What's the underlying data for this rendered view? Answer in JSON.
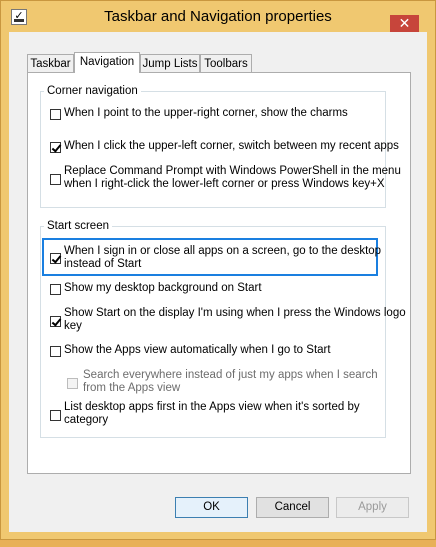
{
  "window": {
    "title": "Taskbar and Navigation properties",
    "close_glyph": "✕"
  },
  "tabs": [
    {
      "label": "Taskbar",
      "active": false
    },
    {
      "label": "Navigation",
      "active": true
    },
    {
      "label": "Jump Lists",
      "active": false
    },
    {
      "label": "Toolbars",
      "active": false
    }
  ],
  "corner_navigation": {
    "heading": "Corner navigation",
    "options": [
      {
        "lines": [
          "When I point to the upper-right corner, show the charms"
        ],
        "checked": false,
        "enabled": true
      },
      {
        "lines": [
          "When I click the upper-left corner, switch between my recent apps"
        ],
        "checked": true,
        "enabled": true
      },
      {
        "lines": [
          "Replace Command Prompt with Windows PowerShell in the menu",
          "when I right-click the lower-left corner or press Windows key+X"
        ],
        "checked": false,
        "enabled": true
      }
    ]
  },
  "start_screen": {
    "heading": "Start screen",
    "options": [
      {
        "lines": [
          "When I sign in or close all apps on a screen, go to the desktop",
          "instead of Start"
        ],
        "checked": true,
        "enabled": true,
        "focused": true
      },
      {
        "lines": [
          "Show my desktop background on Start"
        ],
        "checked": false,
        "enabled": true
      },
      {
        "lines": [
          "Show Start on the display I'm using when I press the Windows logo",
          "key"
        ],
        "checked": true,
        "enabled": true
      },
      {
        "lines": [
          "Show the Apps view automatically when I go to Start"
        ],
        "checked": false,
        "enabled": true
      },
      {
        "lines": [
          "Search everywhere instead of just my apps when I search",
          "from the Apps view"
        ],
        "checked": false,
        "enabled": false
      },
      {
        "lines": [
          "List desktop apps first in the Apps view when it's sorted by",
          "category"
        ],
        "checked": false,
        "enabled": true
      }
    ]
  },
  "buttons": {
    "ok": "OK",
    "cancel": "Cancel",
    "apply": "Apply"
  },
  "colors": {
    "title_bar": "#f0c870",
    "close_button": "#c7453b",
    "focus_outline": "#1a7fe0"
  }
}
